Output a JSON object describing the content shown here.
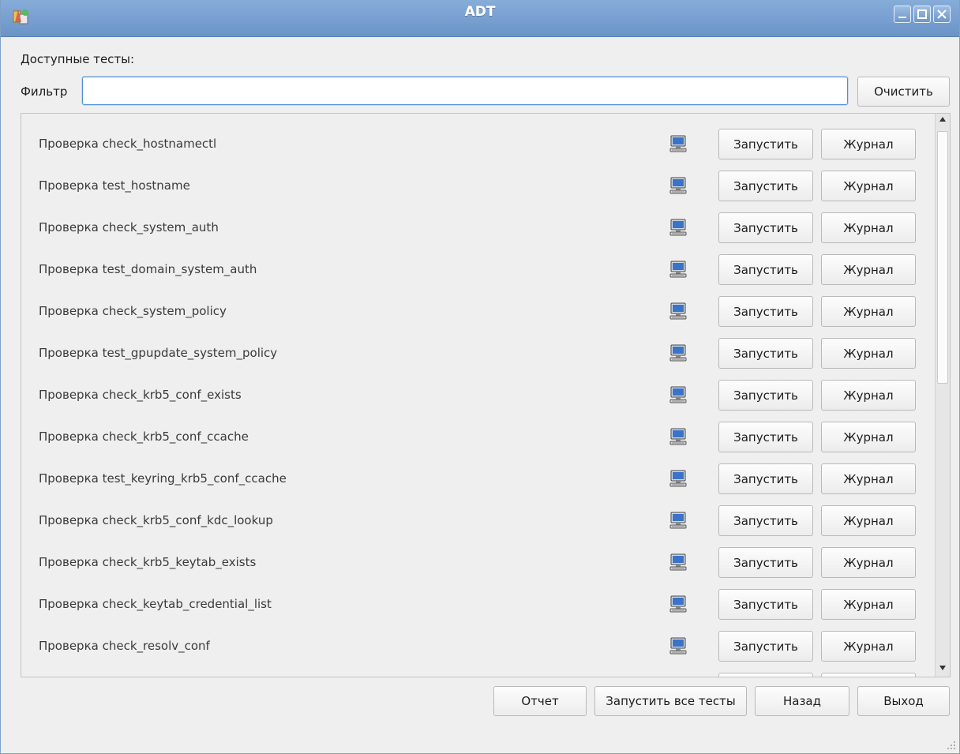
{
  "window": {
    "title": "ADT"
  },
  "header": {
    "available_tests_label": "Доступные тесты:",
    "filter_label": "Фильтр",
    "filter_value": "",
    "clear_button": "Очистить"
  },
  "tests": [
    {
      "label": "Проверка check_hostnamectl",
      "run": "Запустить",
      "log": "Журнал"
    },
    {
      "label": "Проверка test_hostname",
      "run": "Запустить",
      "log": "Журнал"
    },
    {
      "label": "Проверка check_system_auth",
      "run": "Запустить",
      "log": "Журнал"
    },
    {
      "label": "Проверка test_domain_system_auth",
      "run": "Запустить",
      "log": "Журнал"
    },
    {
      "label": "Проверка check_system_policy",
      "run": "Запустить",
      "log": "Журнал"
    },
    {
      "label": "Проверка test_gpupdate_system_policy",
      "run": "Запустить",
      "log": "Журнал"
    },
    {
      "label": "Проверка check_krb5_conf_exists",
      "run": "Запустить",
      "log": "Журнал"
    },
    {
      "label": "Проверка check_krb5_conf_ccache",
      "run": "Запустить",
      "log": "Журнал"
    },
    {
      "label": "Проверка test_keyring_krb5_conf_ccache",
      "run": "Запустить",
      "log": "Журнал"
    },
    {
      "label": "Проверка check_krb5_conf_kdc_lookup",
      "run": "Запустить",
      "log": "Журнал"
    },
    {
      "label": "Проверка check_krb5_keytab_exists",
      "run": "Запустить",
      "log": "Журнал"
    },
    {
      "label": "Проверка check_keytab_credential_list",
      "run": "Запустить",
      "log": "Журнал"
    },
    {
      "label": "Проверка check_resolv_conf",
      "run": "Запустить",
      "log": "Журнал"
    },
    {
      "label": "",
      "run": "",
      "log": ""
    }
  ],
  "row_icon": "computer-icon",
  "footer": {
    "report_button": "Отчет",
    "run_all_button": "Запустить все тесты",
    "back_button": "Назад",
    "exit_button": "Выход"
  },
  "colors": {
    "titlebar": "#6b94c7",
    "window_bg": "#efefef",
    "focus_border": "#4f91d8"
  }
}
